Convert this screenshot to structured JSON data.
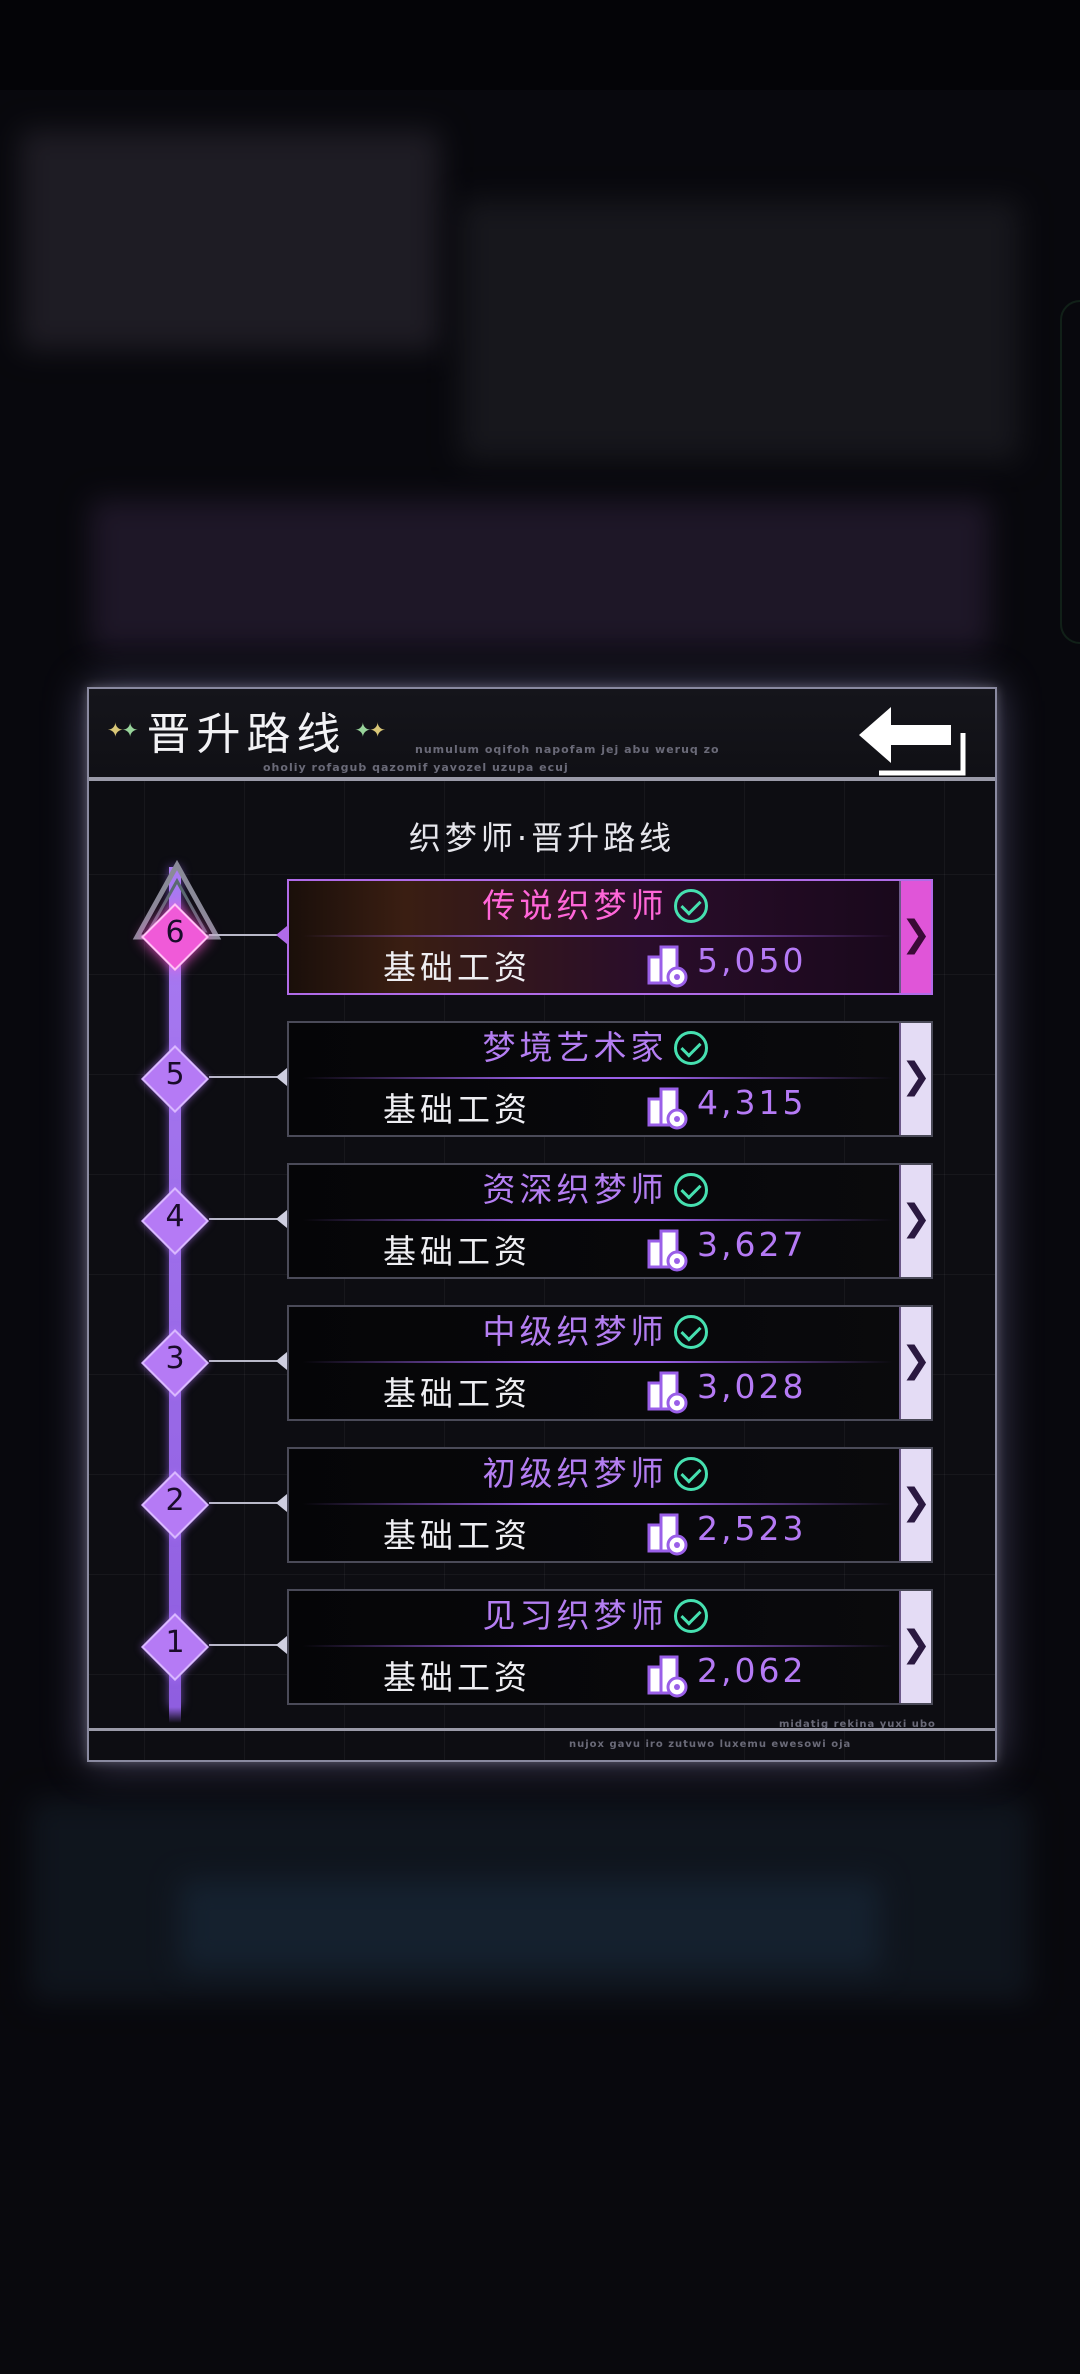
{
  "panel": {
    "title": "晋升路线",
    "deco_text_1": "numulum oqifoh napofam jej abu weruq zo",
    "deco_text_2": "oholiy rofagub qazomif yavozel uzupa ecuj",
    "subtitle": "织梦师·晋升路线",
    "footer_text_1": "midatig rekina yuxi ubo",
    "footer_text_2": "nujox gavu iro zutuwo luxemu ewesowi oja",
    "back_icon": "back-arrow-icon"
  },
  "ranks": [
    {
      "level": "6",
      "title": "传说织梦师",
      "wage_label": "基础工资",
      "wage": "5,050",
      "current": true
    },
    {
      "level": "5",
      "title": "梦境艺术家",
      "wage_label": "基础工资",
      "wage": "4,315",
      "current": false
    },
    {
      "level": "4",
      "title": "资深织梦师",
      "wage_label": "基础工资",
      "wage": "3,627",
      "current": false
    },
    {
      "level": "3",
      "title": "中级织梦师",
      "wage_label": "基础工资",
      "wage": "3,028",
      "current": false
    },
    {
      "level": "2",
      "title": "初级织梦师",
      "wage_label": "基础工资",
      "wage": "2,523",
      "current": false
    },
    {
      "level": "1",
      "title": "见习织梦师",
      "wage_label": "基础工资",
      "wage": "2,062",
      "current": false
    }
  ],
  "icons": {
    "check": "check-circle-icon",
    "coin": "coin-stack-icon",
    "arrow": "chevron-right-icon"
  },
  "colors": {
    "accent_purple": "#b57af5",
    "accent_pink": "#f05ad8",
    "check_green": "#46e0b0"
  }
}
